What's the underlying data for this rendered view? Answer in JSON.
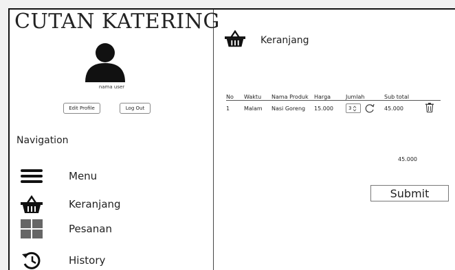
{
  "app": {
    "title": "CUTAN KATERING"
  },
  "user": {
    "name": "nama user"
  },
  "sidebar_buttons": {
    "edit_profile": "Edit Profile",
    "log_out": "Log Out"
  },
  "navigation": {
    "heading": "Navigation",
    "items": [
      {
        "label": "Menu",
        "icon": "hamburger-icon"
      },
      {
        "label": "Keranjang",
        "icon": "basket-icon"
      },
      {
        "label": "Pesanan",
        "icon": "grid-icon"
      },
      {
        "label": "History",
        "icon": "history-icon"
      }
    ]
  },
  "cart": {
    "title": "Keranjang",
    "columns": [
      "No",
      "Waktu",
      "Nama Produk",
      "Harga",
      "Jumlah",
      "Sub total"
    ],
    "rows": [
      {
        "no": "1",
        "waktu": "Malam",
        "produk": "Nasi Goreng",
        "harga": "15.000",
        "jumlah": "3",
        "subtotal": "45.000"
      }
    ],
    "total": "45.000",
    "submit_label": "Submit"
  }
}
